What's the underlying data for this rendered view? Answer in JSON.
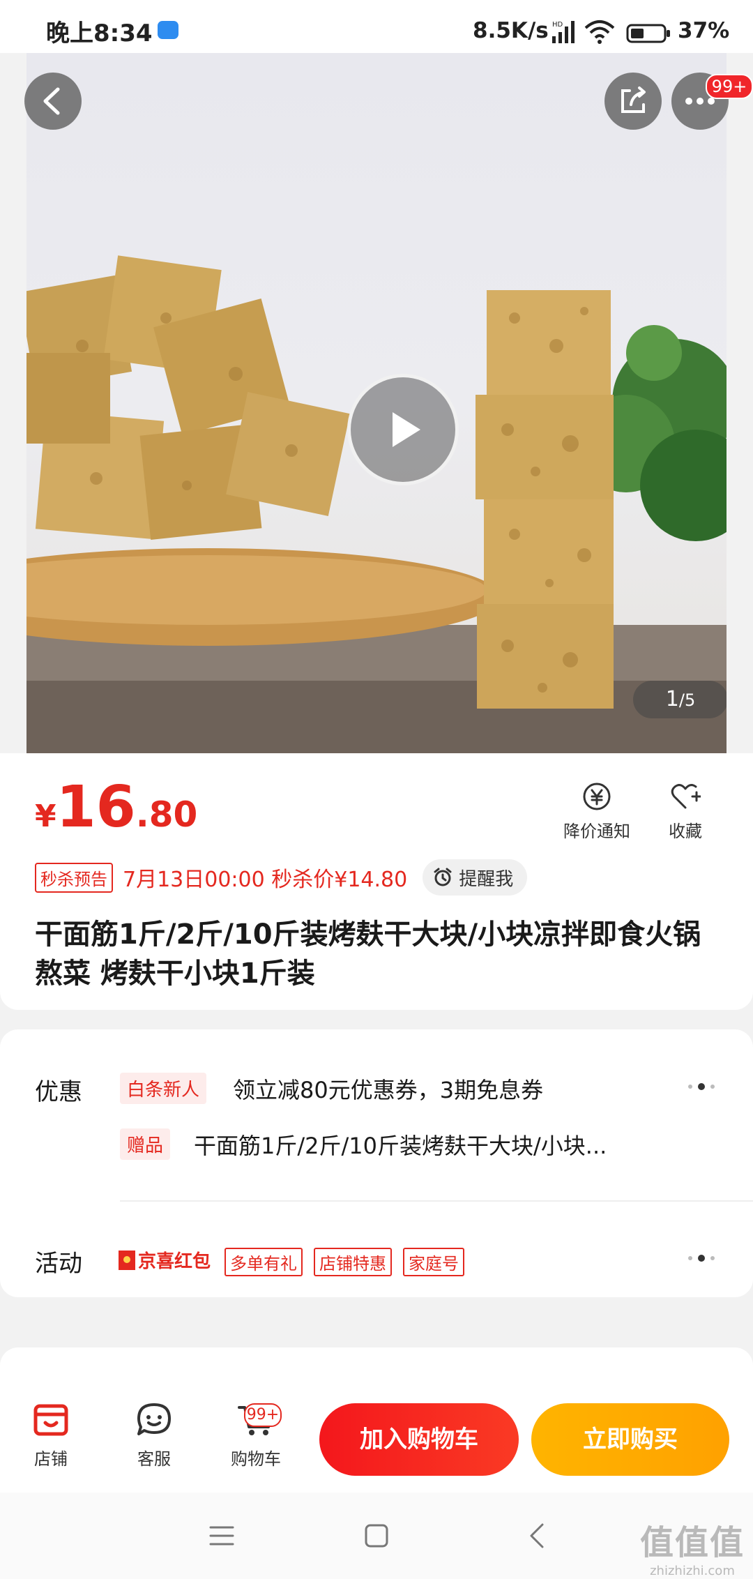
{
  "status_bar": {
    "time": "晚上8:34",
    "network_speed": "8.5K/s",
    "battery": "37%",
    "hd_label": "HD"
  },
  "gallery": {
    "more_badge": "99+",
    "counter_current": "1",
    "counter_total": "/5"
  },
  "product": {
    "currency": "¥",
    "price_int": "16",
    "price_dec": ".80",
    "price_alert_label": "降价通知",
    "favorite_label": "收藏",
    "seckill_tag": "秒杀预告",
    "seckill_info": "7月13日00:00 秒杀价¥14.80",
    "remind_label": "提醒我",
    "title": "干面筋1斤/2斤/10斤装烤麸干大块/小块凉拌即食火锅熬菜 烤麸干小块1斤装"
  },
  "offers": {
    "label": "优惠",
    "coupon_tag": "白条新人",
    "coupon_text": "领立减80元优惠券，3期免息券",
    "gift_tag": "赠品",
    "gift_text": "干面筋1斤/2斤/10斤装烤麸干大块/小块..."
  },
  "activities": {
    "label": "活动",
    "tags": [
      "京喜红包",
      "多单有礼",
      "店铺特惠",
      "家庭号"
    ]
  },
  "bottom_bar": {
    "store_label": "店铺",
    "service_label": "客服",
    "cart_label": "购物车",
    "cart_badge": "99+",
    "add_to_cart": "加入购物车",
    "buy_now": "立即购买"
  },
  "watermark": {
    "main": "值值值",
    "sub": "zhizhizhi.com"
  },
  "colors": {
    "accent_red": "#e4281f",
    "buy_orange": "#ffb400",
    "badge_red": "#f0262a"
  }
}
